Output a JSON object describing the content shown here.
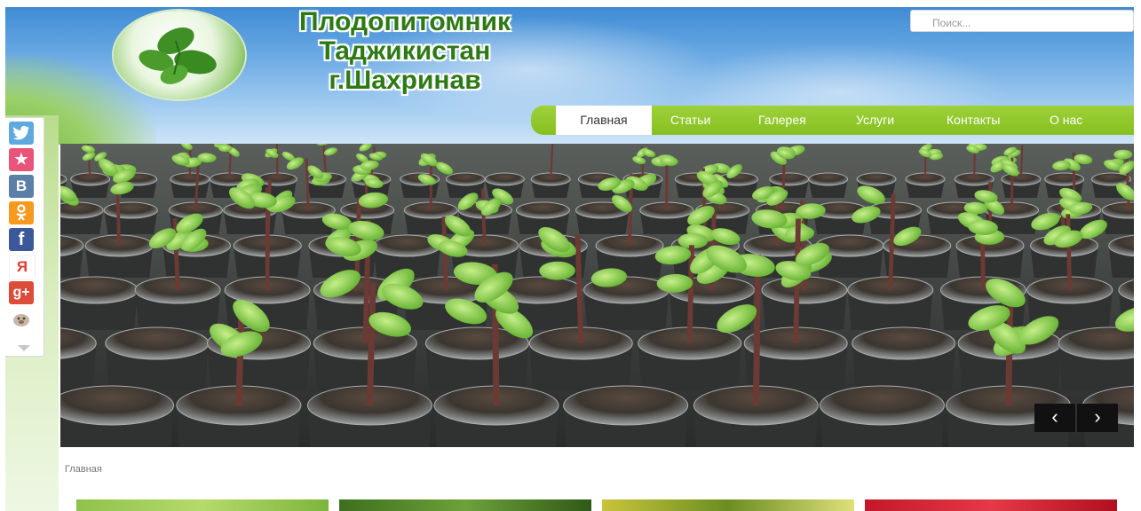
{
  "logo": {
    "lines": [
      "Плодопитомник",
      "Таджикистан",
      "г.Шахринав"
    ]
  },
  "search": {
    "placeholder": "Поиск..."
  },
  "nav": {
    "items": [
      {
        "label": "Главная",
        "active": true
      },
      {
        "label": "Статьи",
        "active": false
      },
      {
        "label": "Галерея",
        "active": false
      },
      {
        "label": "Услуги",
        "active": false
      },
      {
        "label": "Контакты",
        "active": false
      },
      {
        "label": "О нас",
        "active": false
      }
    ]
  },
  "social": {
    "items": [
      {
        "icon": "twitter-icon",
        "glyph": "✦",
        "color": "#5ea9dd"
      },
      {
        "icon": "favorite-star-icon",
        "glyph": "★",
        "color": "#e8547a"
      },
      {
        "icon": "vkontakte-icon",
        "glyph": "В",
        "color": "#5b7fa6"
      },
      {
        "icon": "odnoklassniki-icon",
        "glyph": "ok",
        "color": "#f59a1f"
      },
      {
        "icon": "facebook-icon",
        "glyph": "f",
        "color": "#3b5998"
      },
      {
        "icon": "yandex-icon",
        "glyph": "Я",
        "color": "#ffffff"
      },
      {
        "icon": "google-plus-icon",
        "glyph": "g+",
        "color": "#dd4b39"
      },
      {
        "icon": "mail-ru-icon",
        "glyph": "@",
        "color": "#ffffff"
      }
    ]
  },
  "slider": {
    "prev": "‹",
    "next": "›"
  },
  "breadcrumb": {
    "current": "Главная"
  },
  "colors": {
    "accent": "#8cc63f",
    "logo_text": "#2d7a15"
  }
}
